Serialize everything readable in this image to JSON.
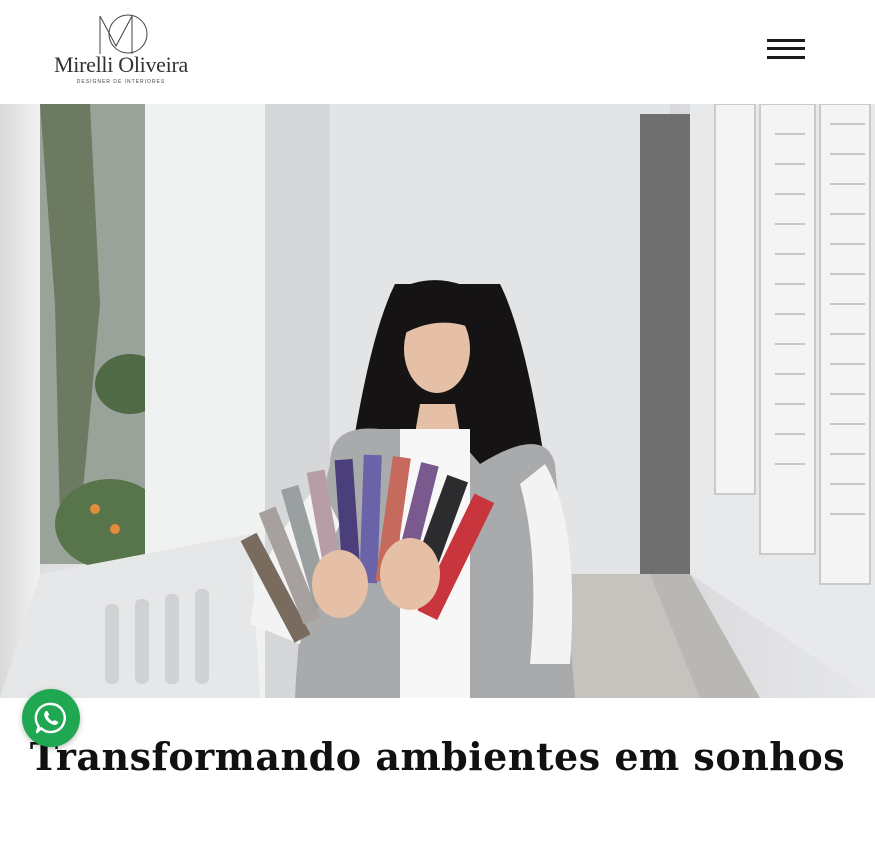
{
  "header": {
    "logo_name": "Mirelli Oliveira",
    "logo_tagline": "DESIGNER DE INTERIORES",
    "menu_icon": "hamburger-menu-icon"
  },
  "hero": {
    "image_alt": "Designer de interiores segurando catálogo de cores Suvinil em uma varanda"
  },
  "headline": "Transformando ambientes em sonhos",
  "whatsapp": {
    "icon": "whatsapp-icon",
    "color": "#1fa851"
  }
}
